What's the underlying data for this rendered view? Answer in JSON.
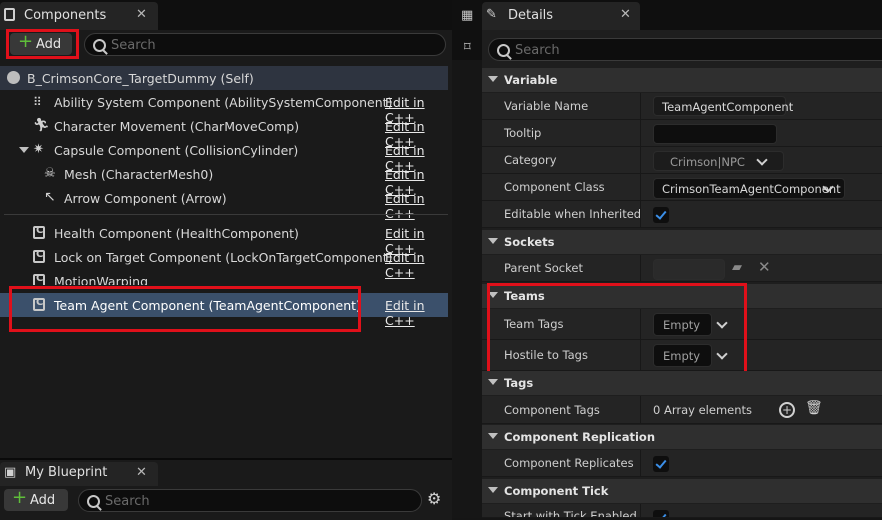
{
  "components_panel": {
    "tab_title": "Components",
    "add_label": "Add",
    "search_placeholder": "Search",
    "self_item": "B_CrimsonCore_TargetDummy (Self)",
    "edit_label": "Edit in C++",
    "items": [
      {
        "label": "Ability System Component (AbilitySystemComponent)",
        "icon": "ability-system-icon",
        "editable": true
      },
      {
        "label": "Character Movement (CharMoveComp)",
        "icon": "character-movement-icon",
        "editable": true
      },
      {
        "label": "Capsule Component (CollisionCylinder)",
        "icon": "capsule-icon",
        "editable": true
      },
      {
        "label": "Mesh (CharacterMesh0)",
        "icon": "skeletal-mesh-icon",
        "editable": true
      },
      {
        "label": "Arrow Component (Arrow)",
        "icon": "arrow-icon",
        "editable": true
      },
      {
        "label": "Health Component (HealthComponent)",
        "icon": "cpp-class-icon",
        "editable": true
      },
      {
        "label": "Lock on Target Component (LockOnTargetComponent)",
        "icon": "cpp-class-icon",
        "editable": true
      },
      {
        "label": "MotionWarping",
        "icon": "cpp-class-icon",
        "editable": false
      },
      {
        "label": "Team Agent Component (TeamAgentComponent)",
        "icon": "cpp-class-icon",
        "editable": true,
        "selected": true
      }
    ]
  },
  "my_blueprint_panel": {
    "tab_title": "My Blueprint",
    "add_label": "Add",
    "search_placeholder": "Search"
  },
  "details_panel": {
    "tab_title": "Details",
    "search_placeholder": "Search",
    "sections": {
      "variable": "Variable",
      "sockets": "Sockets",
      "teams": "Teams",
      "tags": "Tags",
      "component_replication": "Component Replication",
      "component_tick": "Component Tick"
    },
    "properties": {
      "variable_name": {
        "label": "Variable Name",
        "value": "TeamAgentComponent"
      },
      "tooltip": {
        "label": "Tooltip",
        "value": ""
      },
      "category": {
        "label": "Category",
        "value": "Crimson|NPC"
      },
      "component_class": {
        "label": "Component Class",
        "value": "CrimsonTeamAgentComponent"
      },
      "editable_when_inherited": {
        "label": "Editable when Inherited",
        "checked": true
      },
      "parent_socket": {
        "label": "Parent Socket",
        "value": ""
      },
      "team_tags": {
        "label": "Team Tags",
        "value": "Empty"
      },
      "hostile_to_tags": {
        "label": "Hostile to Tags",
        "value": "Empty"
      },
      "component_tags": {
        "label": "Component Tags",
        "value": "0 Array elements"
      },
      "component_replicates": {
        "label": "Component Replicates",
        "checked": true
      },
      "start_with_tick_enabled": {
        "label": "Start with Tick Enabled",
        "checked": true
      }
    }
  },
  "colors": {
    "highlight_red": "#e0101a",
    "selection_blue": "#3b506b",
    "checkbox_blue": "#3b8fe8",
    "add_plus_green": "#5fbf3a"
  }
}
